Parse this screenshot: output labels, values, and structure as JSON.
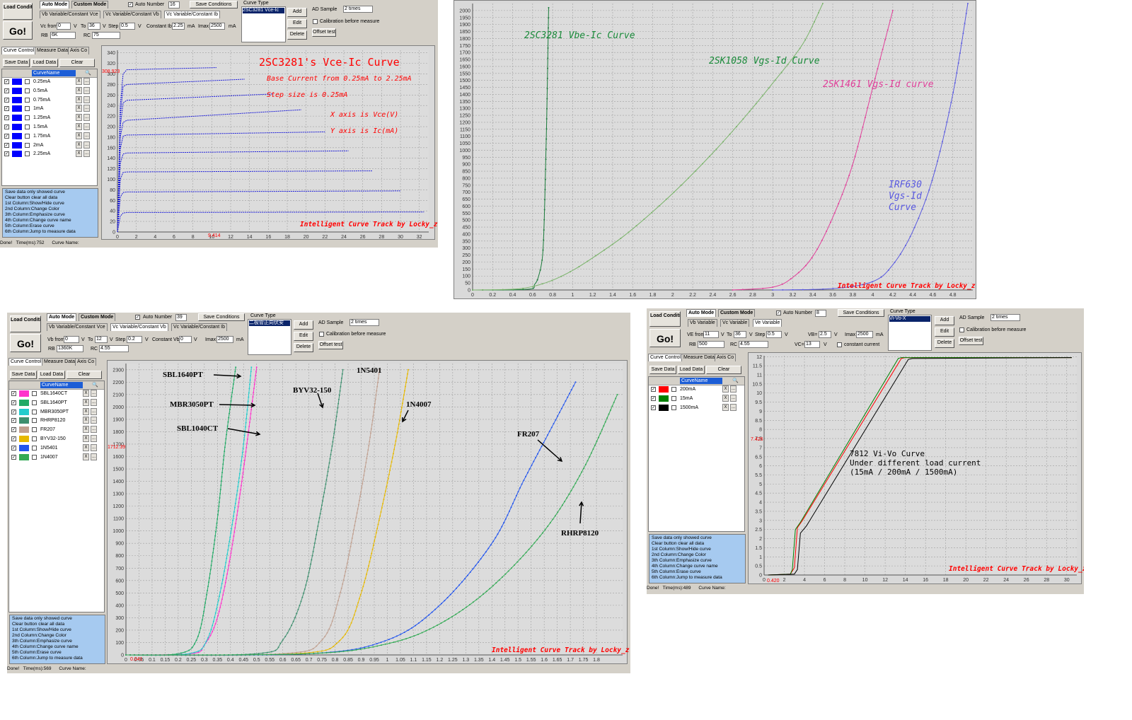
{
  "common": {
    "load_conditions": "Load Conditions",
    "go": "Go!",
    "tab_auto_mode": "Auto Mode",
    "tab_custom_mode": "Custom Mode",
    "auto_number": "Auto Number",
    "save_conditions": "Save Conditions",
    "curve_type": "Curve Type",
    "add": "Add",
    "edit": "Edit",
    "delete": "Delete",
    "ad_sample": "AD Sample",
    "ad_sample_value": "2 times",
    "calibration": "Calibration before measure",
    "offset_test": "Offset test",
    "tab_curve_control": "Curve Control",
    "tab_measure_data": "Measure Data",
    "tab_axis": "Axis Co",
    "save_data": "Save Data",
    "load_data": "Load Data",
    "clear": "Clear",
    "col_curvename": "CurveName",
    "credit": "Intelligent Curve Track by Locky_z",
    "status_done": "Done!",
    "curve_name_label": "Curve Name:",
    "info_lines": [
      "Save data only showed curve",
      "Clear button clear all data",
      "1st Column:Show/Hide curve",
      "2nd Column:Change Color",
      "3th Column:Emphasize curve",
      "4th Column:Change curve name",
      "5th Column:Erase curve",
      "6th Column:Jump to measure data"
    ],
    "x_btn": "X",
    "dots_btn": "..."
  },
  "win1": {
    "mode_tabs": [
      "Vb Variable/Constant Vce",
      "Vc Variable/Constant Vb",
      "Vc Variable/Constant Ib"
    ],
    "auto_number_value": "16",
    "curve_type_selected": "2SC3281 Vce-Ic",
    "fields": {
      "vc_from_label": "Vc from",
      "vc_from": "0",
      "v1": "V",
      "to_label": "To",
      "to": "36",
      "v2": "V",
      "step_label": "Step",
      "step": "0.5",
      "v3": "V",
      "const_ib_label": "Constant Ib",
      "const_ib": "2.25",
      "ma1": "mA",
      "imax_label": "Imax",
      "imax": "2500",
      "ma2": "mA",
      "rb_label": "RB",
      "rb": "6K",
      "rc_label": "RC",
      "rc": "75"
    },
    "curves": [
      "0.25mA",
      "0.5mA",
      "0.75mA",
      "1mA",
      "1.25mA",
      "1.5mA",
      "1.75mA",
      "2mA",
      "2.25mA"
    ],
    "curve_color": "#0000ff",
    "status_time": "Time(ms):752",
    "marker_y": "308.923",
    "marker_x": "9.414",
    "annotations": {
      "title": "2SC3281's Vce-Ic Curve",
      "line1": "Base Current from 0.25mA to 2.25mA",
      "line2": "Step size is 0.25mA",
      "line3": "X axis is Vce(V)",
      "line4": "Y axis is Ic(mA)"
    }
  },
  "win2": {
    "annotations": {
      "a1": "2SC3281 Vbe-Ic Curve",
      "a2": "2SK1058 Vgs-Id Curve",
      "a3": "2SK1461 Vgs-Id curve",
      "a4": "IRF630 Vgs-Id Curve"
    }
  },
  "win3": {
    "mode_tabs": [
      "Vb Variable/Constant Vce",
      "Vc Variable/Constant Vb",
      "Vc Variable/Constant Ib"
    ],
    "auto_number_value": "39",
    "curve_type_selected": "二极管正向伏安",
    "fields": {
      "vc_from_label": "Vb from",
      "vc_from": "0",
      "v1": "V",
      "to_label": "To",
      "to": "12",
      "v2": "V",
      "step_label": "Step",
      "step": "0.2",
      "v3": "V",
      "const_label": "Constant Vb",
      "const": "0",
      "v4": "V",
      "imax_label": "Imax",
      "imax": "2500",
      "ma2": "mA",
      "rb_label": "RB",
      "rb": "1360K",
      "rc_label": "RC",
      "rc": "4.55"
    },
    "curves": [
      {
        "name": "SBL1640CT",
        "color": "#ff33cc"
      },
      {
        "name": "SBL1640PT",
        "color": "#22aa66"
      },
      {
        "name": "MBR3050PT",
        "color": "#22cccc"
      },
      {
        "name": "RHRP8120",
        "color": "#3d8f6e"
      },
      {
        "name": "FR207",
        "color": "#c0a090"
      },
      {
        "name": "BYV32-150",
        "color": "#e6b800"
      },
      {
        "name": "1N5401",
        "color": "#2255ee"
      },
      {
        "name": "1N4007",
        "color": "#33aa55"
      }
    ],
    "status_time": "Time(ms):569",
    "marker_y": "1712.39",
    "marker_x": "0.041",
    "labels": {
      "sbl1640pt": "SBL1640PT",
      "mbr3050pt": "MBR3050PT",
      "sbl1040ct": "SBL1040CT",
      "byv32": "BYV32-150",
      "n5401": "1N5401",
      "n4007": "1N4007",
      "fr207": "FR207",
      "rhrp8120": "RHRP8120"
    }
  },
  "win4": {
    "mode_tabs": [
      "Vb Variable",
      "Vc Variable",
      "Ve Variable"
    ],
    "auto_number_value": "8",
    "curve_type_selected": "Vi-Vo-X",
    "fields": {
      "vc_from_label": "VE from",
      "vc_from": "11",
      "v1": "V",
      "to_label": "To",
      "to": "36",
      "v2": "V",
      "step_label": "Step",
      "step": "0.5",
      "v3": "V",
      "vb_label": "VB=",
      "vb": "2.5",
      "v4": "V",
      "imax_label": "Imax",
      "imax": "2500",
      "ma2": "mA",
      "rb_label": "RB",
      "rb": "500",
      "rc_label": "RC",
      "rc": "4.55",
      "vc_label": "VC=",
      "vc": "13",
      "v5": "V",
      "const_current": "constant current"
    },
    "curves": [
      {
        "name": "200mA",
        "color": "#ff0000"
      },
      {
        "name": "15mA",
        "color": "#008000"
      },
      {
        "name": "1500mA",
        "color": "#000000"
      }
    ],
    "status_time": "Time(ms):489",
    "marker_y": "7.426",
    "marker_x": "0.420",
    "annotations": {
      "l1": "7812 Vi-Vo Curve",
      "l2": "Under different load current",
      "l3": "(15mA / 200mA / 1500mA)"
    }
  },
  "chart_data": [
    {
      "type": "line",
      "title": "2SC3281's Vce-Ic Curve",
      "xlabel": "Vce(V)",
      "ylabel": "Ic(mA)",
      "xlim": [
        0,
        33
      ],
      "ylim": [
        0,
        345
      ],
      "x_ticks": [
        0,
        2,
        4,
        6,
        8,
        10,
        12,
        14,
        16,
        18,
        20,
        22,
        24,
        26,
        28,
        30,
        32
      ],
      "y_ticks": [
        0,
        20,
        40,
        60,
        80,
        100,
        120,
        140,
        160,
        180,
        200,
        220,
        240,
        260,
        280,
        300,
        320,
        340
      ],
      "series": [
        {
          "name": "0.25mA",
          "x": [
            0,
            0.3,
            0.6,
            1,
            32.5
          ],
          "y": [
            0,
            30,
            36,
            37,
            38
          ]
        },
        {
          "name": "0.5mA",
          "x": [
            0,
            0.3,
            0.6,
            1,
            30
          ],
          "y": [
            0,
            66,
            75,
            76,
            78
          ]
        },
        {
          "name": "0.75mA",
          "x": [
            0,
            0.3,
            0.6,
            1,
            27
          ],
          "y": [
            0,
            100,
            113,
            114,
            116
          ]
        },
        {
          "name": "1mA",
          "x": [
            0,
            0.3,
            0.6,
            1,
            24.5
          ],
          "y": [
            0,
            130,
            148,
            150,
            154
          ]
        },
        {
          "name": "1.25mA",
          "x": [
            0,
            0.3,
            0.6,
            1,
            22
          ],
          "y": [
            0,
            158,
            182,
            184,
            190
          ]
        },
        {
          "name": "1.5mA",
          "x": [
            0,
            0.3,
            0.6,
            1,
            19.5
          ],
          "y": [
            0,
            180,
            208,
            212,
            232
          ]
        },
        {
          "name": "1.75mA",
          "x": [
            0,
            0.3,
            0.6,
            1,
            16.5
          ],
          "y": [
            0,
            200,
            245,
            250,
            262
          ]
        },
        {
          "name": "2mA",
          "x": [
            0,
            0.3,
            0.6,
            1,
            13.5
          ],
          "y": [
            0,
            220,
            276,
            280,
            290
          ]
        },
        {
          "name": "2.25mA",
          "x": [
            0,
            0.3,
            0.6,
            1,
            10.5
          ],
          "y": [
            0,
            240,
            300,
            308,
            312
          ]
        }
      ]
    },
    {
      "type": "line",
      "xlim": [
        0,
        5
      ],
      "ylim": [
        0,
        2050
      ],
      "x_ticks": [
        0,
        0.2,
        0.4,
        0.6,
        0.8,
        1,
        1.2,
        1.4,
        1.6,
        1.8,
        2,
        2.2,
        2.4,
        2.6,
        2.8,
        3,
        3.2,
        3.4,
        3.6,
        3.8,
        4,
        4.2,
        4.4,
        4.6,
        4.8
      ],
      "y_ticks": [
        0,
        50,
        100,
        150,
        200,
        250,
        300,
        350,
        400,
        450,
        500,
        550,
        600,
        650,
        700,
        750,
        800,
        850,
        900,
        950,
        1000,
        1050,
        1100,
        1150,
        1200,
        1250,
        1300,
        1350,
        1400,
        1450,
        1500,
        1550,
        1600,
        1650,
        1700,
        1750,
        1800,
        1850,
        1900,
        1950,
        2000
      ],
      "series": [
        {
          "name": "2SC3281 Vbe-Ic",
          "color": "#1a7a3a",
          "x": [
            0,
            0.55,
            0.62,
            0.66,
            0.7,
            0.72,
            0.74,
            0.76
          ],
          "y": [
            0,
            5,
            40,
            100,
            250,
            600,
            1200,
            2020
          ]
        },
        {
          "name": "2SK1058 Vgs-Id",
          "color": "#7ab36a",
          "x": [
            0,
            0.4,
            0.6,
            0.8,
            1.0,
            1.2,
            1.5,
            1.8,
            2.1,
            2.4,
            2.7,
            3.0,
            3.3,
            3.5
          ],
          "y": [
            0,
            5,
            25,
            70,
            140,
            230,
            380,
            560,
            760,
            980,
            1220,
            1480,
            1760,
            2050
          ]
        },
        {
          "name": "2SK1461 Vgs-Id",
          "color": "#e0409a",
          "x": [
            2.6,
            3.0,
            3.2,
            3.4,
            3.6,
            3.8,
            4.0,
            4.2
          ],
          "y": [
            0,
            20,
            90,
            240,
            520,
            900,
            1450,
            2000
          ]
        },
        {
          "name": "IRF630 Vgs-Id",
          "color": "#5a5ae0",
          "x": [
            3.0,
            3.6,
            4.0,
            4.2,
            4.4,
            4.6,
            4.8,
            4.95
          ],
          "y": [
            0,
            10,
            60,
            180,
            420,
            800,
            1400,
            2050
          ]
        }
      ]
    },
    {
      "type": "line",
      "xlim": [
        0,
        1.9
      ],
      "ylim": [
        0,
        2350
      ],
      "x_ticks": [
        0,
        0.05,
        0.1,
        0.15,
        0.2,
        0.25,
        0.3,
        0.35,
        0.4,
        0.45,
        0.5,
        0.55,
        0.6,
        0.65,
        0.7,
        0.75,
        0.8,
        0.85,
        0.9,
        0.95,
        1,
        1.05,
        1.1,
        1.15,
        1.2,
        1.25,
        1.3,
        1.35,
        1.4,
        1.45,
        1.5,
        1.55,
        1.6,
        1.65,
        1.7,
        1.75,
        1.8
      ],
      "y_ticks": [
        0,
        100,
        200,
        300,
        400,
        500,
        600,
        700,
        800,
        900,
        1000,
        1100,
        1200,
        1300,
        1400,
        1500,
        1600,
        1700,
        1800,
        1900,
        2000,
        2100,
        2200,
        2300
      ],
      "series": [
        {
          "name": "SBL1640CT",
          "x": [
            0,
            0.25,
            0.3,
            0.35,
            0.4,
            0.45,
            0.5
          ],
          "y": [
            0,
            10,
            80,
            300,
            800,
            1500,
            2320
          ]
        },
        {
          "name": "SBL1640PT",
          "x": [
            0,
            0.2,
            0.27,
            0.31,
            0.35,
            0.38,
            0.42
          ],
          "y": [
            0,
            10,
            120,
            500,
            1100,
            1700,
            2320
          ]
        },
        {
          "name": "MBR3050PT",
          "x": [
            0,
            0.24,
            0.31,
            0.36,
            0.41,
            0.45,
            0.48
          ],
          "y": [
            0,
            10,
            120,
            500,
            1100,
            1700,
            2320
          ]
        },
        {
          "name": "BYV32-150",
          "x": [
            0,
            0.5,
            0.6,
            0.68,
            0.74,
            0.79,
            0.83
          ],
          "y": [
            0,
            10,
            120,
            500,
            1100,
            1700,
            2300
          ]
        },
        {
          "name": "1N5401",
          "x": [
            0,
            0.6,
            0.75,
            0.82,
            0.88,
            0.93,
            0.97
          ],
          "y": [
            0,
            10,
            120,
            500,
            1100,
            1700,
            2300
          ]
        },
        {
          "name": "1N4007",
          "x": [
            0,
            0.65,
            0.82,
            0.9,
            0.97,
            1.03,
            1.08
          ],
          "y": [
            0,
            10,
            120,
            500,
            1100,
            1700,
            2300
          ]
        },
        {
          "name": "FR207",
          "x": [
            0,
            0.7,
            1.0,
            1.2,
            1.4,
            1.52,
            1.62,
            1.72
          ],
          "y": [
            0,
            10,
            120,
            400,
            900,
            1400,
            1800,
            2200
          ]
        },
        {
          "name": "RHRP8120",
          "x": [
            0,
            0.7,
            1.0,
            1.2,
            1.4,
            1.6,
            1.75,
            1.88
          ],
          "y": [
            0,
            10,
            90,
            250,
            550,
            1000,
            1500,
            2100
          ]
        }
      ]
    },
    {
      "type": "line",
      "title": "7812 Vi-Vo Curve",
      "xlim": [
        0,
        31
      ],
      "ylim": [
        0,
        12.05
      ],
      "x_ticks": [
        0,
        2,
        4,
        6,
        8,
        10,
        12,
        14,
        16,
        18,
        20,
        22,
        24,
        26,
        28,
        30
      ],
      "y_ticks": [
        0,
        0.5,
        1,
        1.5,
        2,
        2.5,
        3,
        3.5,
        4,
        4.5,
        5,
        5.5,
        6,
        6.5,
        7,
        7.5,
        8,
        8.5,
        9,
        9.5,
        10,
        10.5,
        11,
        11.5,
        12
      ],
      "series": [
        {
          "name": "200mA",
          "x": [
            0.4,
            2.6,
            3.0,
            3.3,
            3.8,
            13.6,
            14.0,
            30.5
          ],
          "y": [
            0,
            0.05,
            0.4,
            2.6,
            3.0,
            11.9,
            11.95,
            11.95
          ]
        },
        {
          "name": "15mA",
          "x": [
            0.4,
            2.6,
            2.8,
            3.1,
            3.6,
            13.3,
            13.6,
            30.5
          ],
          "y": [
            0,
            0.05,
            0.3,
            2.5,
            2.9,
            11.9,
            11.95,
            11.95
          ]
        },
        {
          "name": "1500mA",
          "x": [
            0.4,
            3.0,
            3.3,
            3.6,
            4.2,
            14.3,
            14.7,
            30.5
          ],
          "y": [
            0,
            0.05,
            0.3,
            2.3,
            2.7,
            11.85,
            11.9,
            11.95
          ]
        }
      ]
    }
  ]
}
